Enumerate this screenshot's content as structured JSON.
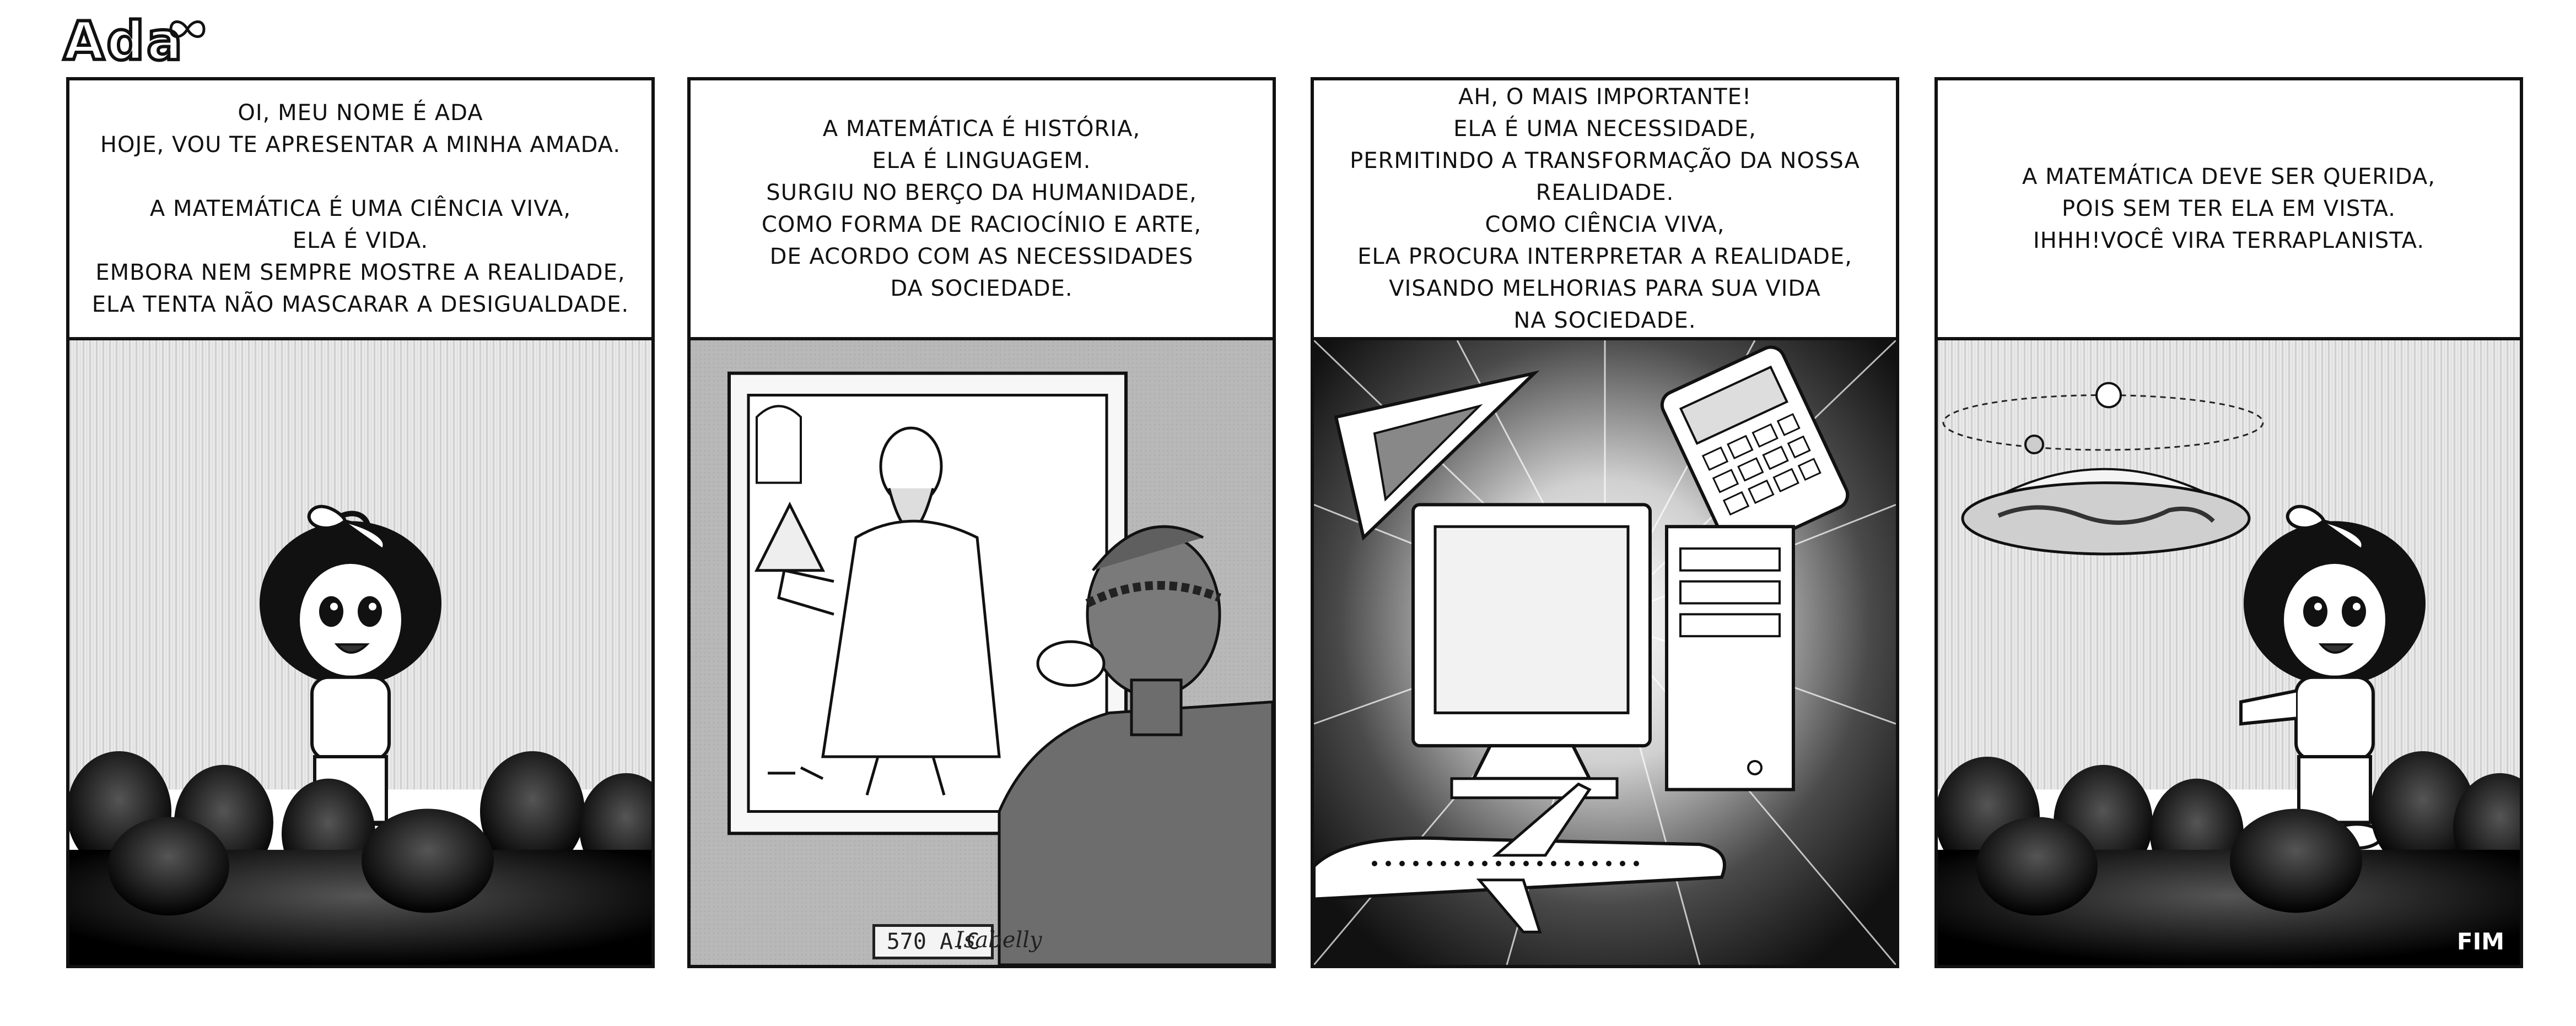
{
  "logo": {
    "text": "Ada"
  },
  "panels": [
    {
      "caption": "OI, MEU NOME É ADA\nHOJE, VOU TE APRESENTAR A MINHA AMADA.\n\nA MATEMÁTICA É UMA CIÊNCIA VIVA,\nELA É VIDA.\nEMBORA NEM SEMPRE MOSTRE A REALIDADE,\nELA TENTA NÃO MASCARAR A DESIGUALDADE."
    },
    {
      "caption": "A MATEMÁTICA É HISTÓRIA,\nELA É LINGUAGEM.\nSURGIU NO BERÇO DA HUMANIDADE,\nCOMO FORMA DE RACIOCÍNIO E ARTE,\nDE ACORDO COM AS NECESSIDADES\nDA SOCIEDADE.",
      "price_tag": "570 A.C",
      "signature": "Isabelly"
    },
    {
      "caption": "AH, O MAIS IMPORTANTE!\nELA É UMA NECESSIDADE,\nPERMITINDO A TRANSFORMAÇÃO DA NOSSA\nREALIDADE.\nCOMO CIÊNCIA VIVA,\nELA PROCURA INTERPRETAR A REALIDADE,\nVISANDO MELHORIAS PARA SUA VIDA\nNA SOCIEDADE."
    },
    {
      "caption": "A MATEMÁTICA DEVE SER QUERIDA,\nPOIS SEM TER ELA EM VISTA.\nIHHH!VOCÊ VIRA TERRAPLANISTA.",
      "end_label": "FIM"
    }
  ]
}
